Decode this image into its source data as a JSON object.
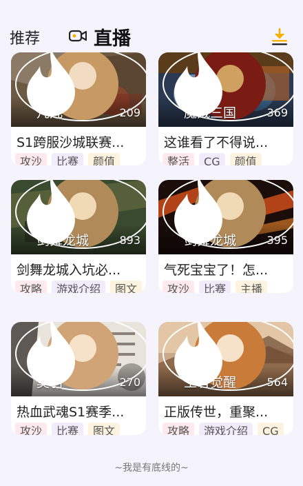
{
  "header": {
    "tab_recommend": "推荐",
    "tab_live": "直播",
    "live_icon": "video-camera-icon",
    "download_icon": "download-icon",
    "accent_color": "#f5b000"
  },
  "cards": [
    {
      "streamer": "凡凡",
      "viewers": "209",
      "title": "S1跨服沙城联赛...",
      "tags": [
        "攻沙",
        "比赛",
        "颜值"
      ]
    },
    {
      "streamer": "魔战三国",
      "viewers": "369",
      "title": "这谁看了不得说...",
      "tags": [
        "整活",
        "CG",
        "颜值"
      ]
    },
    {
      "streamer": "剑舞龙城",
      "viewers": "893",
      "title": "剑舞龙城入坑必...",
      "tags": [
        "攻略",
        "游戏介绍",
        "图文"
      ]
    },
    {
      "streamer": "剑舞龙城",
      "viewers": "395",
      "title": "气死宝宝了！怎...",
      "tags": [
        "攻沙",
        "比赛",
        "主播"
      ]
    },
    {
      "streamer": "莫羽",
      "viewers": "270",
      "title": "热血武魂S1赛季...",
      "tags": [
        "攻沙",
        "比赛",
        "图文"
      ]
    },
    {
      "streamer": "王者觉醒",
      "viewers": "564",
      "title": "正版传世，重聚...",
      "tags": [
        "攻略",
        "游戏介绍",
        "CG"
      ]
    }
  ],
  "footer": "~我是有底线的~"
}
